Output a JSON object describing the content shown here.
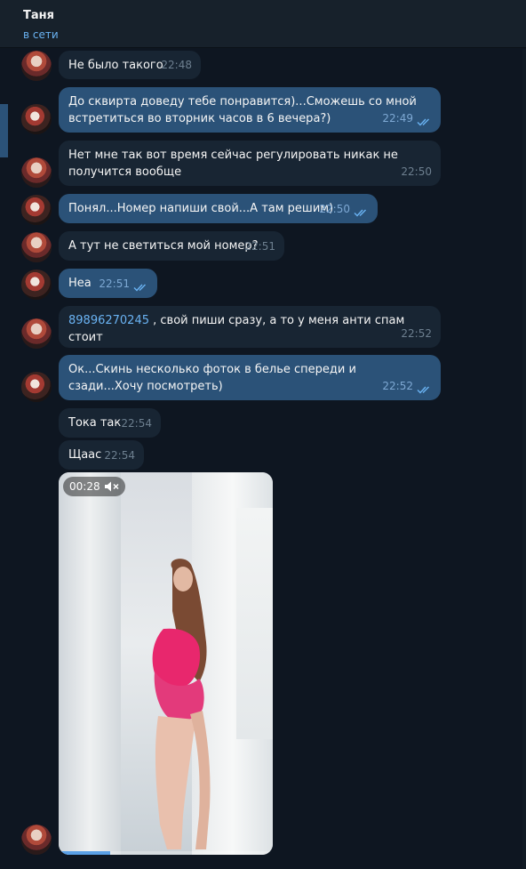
{
  "header": {
    "contact_name": "Таня",
    "status": "в сети"
  },
  "messages": [
    {
      "dir": "in",
      "text": "Не было такого",
      "time": "22:48"
    },
    {
      "dir": "out",
      "text": "До сквирта доведу тебе понравится)...Сможешь со мной встретиться во вторник часов в 6 вечера?)",
      "time": "22:49",
      "read": true
    },
    {
      "dir": "in",
      "text": "Нет мне так вот время сейчас регулировать никак не получится вообще",
      "time": "22:50"
    },
    {
      "dir": "out",
      "text": "Понял...Номер напиши свой...А там решим)",
      "time": "22:50",
      "read": true
    },
    {
      "dir": "in",
      "text": "А тут не светиться мой номер?",
      "time": "22:51"
    },
    {
      "dir": "out",
      "text": "Неа",
      "time": "22:51",
      "read": true
    },
    {
      "dir": "in",
      "phone": "89896270245",
      "text": " , свой пиши сразу,  а то у меня анти спам стоит",
      "time": "22:52"
    },
    {
      "dir": "out",
      "text": "Ок...Скинь несколько фоток в белье спереди и сзади...Хочу посмотреть)",
      "time": "22:52",
      "read": true
    },
    {
      "dir": "in",
      "text": "Тока так",
      "time": "22:54"
    },
    {
      "dir": "in",
      "text": "Щаас",
      "time": "22:54"
    }
  ],
  "video": {
    "duration": "00:28",
    "muted": true,
    "progress": 0.24,
    "sound_icon": "speaker-muted-icon"
  },
  "colors": {
    "bg": "#0e1621",
    "header_bg": "#17212b",
    "incoming_bubble": "#182533",
    "outgoing_bubble": "#2b5278",
    "link": "#6ab3f3",
    "read_check": "#6ab3f3"
  }
}
